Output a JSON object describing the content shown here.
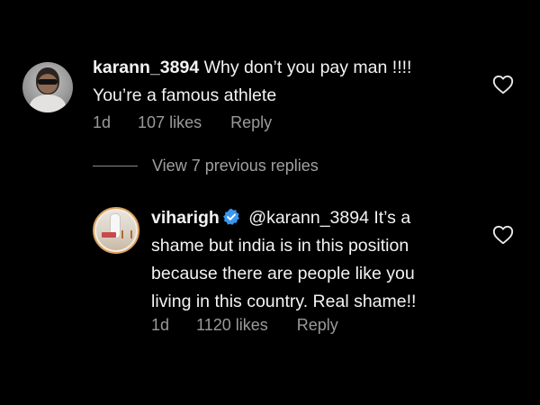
{
  "comments": [
    {
      "username": "karann_3894",
      "line1_rest": " Why don’t you pay man !!!!",
      "line2": "You’re a famous athlete",
      "time": "1d",
      "likes": "107 likes",
      "reply_label": "Reply",
      "avatar_icon": "profile-photo"
    },
    {
      "username": "viharigh",
      "verified": true,
      "line1_rest": " @karann_3894 It’s a",
      "line2": "shame but india is in this position",
      "line3": "because there are people like you",
      "line4": "living in this country. Real shame!!",
      "time": "1d",
      "likes": "1120 likes",
      "reply_label": "Reply",
      "avatar_icon": "profile-photo-cricket"
    }
  ],
  "view_replies": "View 7 previous replies",
  "colors": {
    "background": "#000000",
    "text": "#f3f3f3",
    "muted": "#9a9a9a",
    "verified": "#3897f0"
  },
  "icons": {
    "like": "heart-outline-icon",
    "verified": "verified-badge-icon"
  }
}
